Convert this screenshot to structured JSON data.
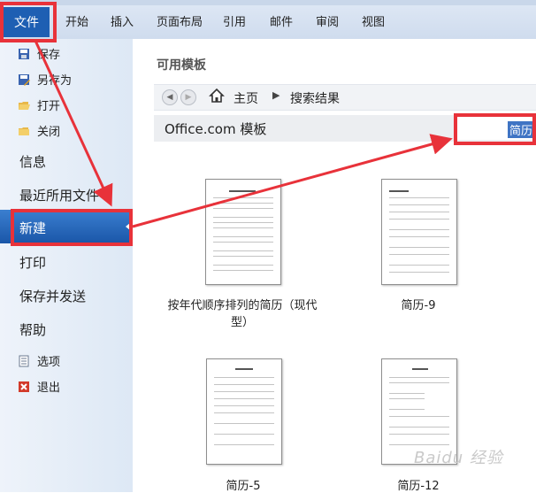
{
  "ribbon": {
    "file_tab": "文件",
    "tabs": [
      "开始",
      "插入",
      "页面布局",
      "引用",
      "邮件",
      "审阅",
      "视图"
    ]
  },
  "nav": {
    "save": "保存",
    "save_as": "另存为",
    "open": "打开",
    "close": "关闭",
    "info": "信息",
    "recent": "最近所用文件",
    "new": "新建",
    "print": "打印",
    "save_send": "保存并发送",
    "help": "帮助",
    "options": "选项",
    "exit": "退出"
  },
  "main": {
    "available_templates": "可用模板",
    "breadcrumb": {
      "home": "主页",
      "results": "搜索结果"
    },
    "results_title": "Office.com 模板",
    "search_value": "简历",
    "templates": [
      {
        "caption": "按年代顺序排列的简历（现代型）"
      },
      {
        "caption": "简历-9"
      },
      {
        "caption": "简历-5"
      },
      {
        "caption": "简历-12"
      }
    ]
  },
  "watermark": "Baidu 经验",
  "colors": {
    "annotation_red": "#e8323a",
    "selected_nav": "#1a56a8",
    "file_tab": "#1e5fb3"
  }
}
